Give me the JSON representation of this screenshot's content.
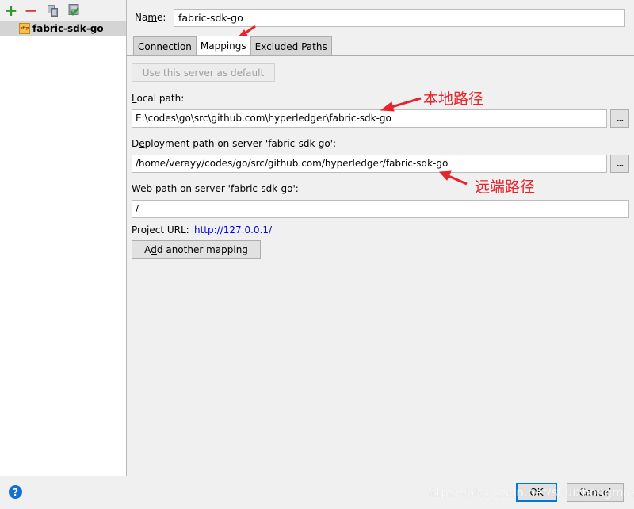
{
  "left_panel": {
    "toolbar": [
      {
        "name": "add-icon",
        "glyph": "+",
        "color": "#2e9a2e"
      },
      {
        "name": "remove-icon",
        "glyph": "−",
        "color": "#d93c3c"
      },
      {
        "name": "copy-icon",
        "glyph": "❐",
        "color": "#7d8a96"
      },
      {
        "name": "set-default-icon",
        "glyph": "✔",
        "color": "#2e9a2e"
      }
    ],
    "servers": [
      {
        "label": "fabric-sdk-go",
        "icon": "sftp",
        "selected": true
      }
    ]
  },
  "form": {
    "name_label_pre": "Na",
    "name_label_u": "m",
    "name_label_post": "e:",
    "name_value": "fabric-sdk-go",
    "tabs": [
      {
        "label": "Connection",
        "active": false
      },
      {
        "label": "Mappings",
        "active": true
      },
      {
        "label": "Excluded Paths",
        "active": false
      }
    ],
    "use_default_button": "Use this server as default",
    "local_path_label_u": "L",
    "local_path_label_rest": "ocal path:",
    "local_path_value": "E:\\codes\\go\\src\\github.com\\hyperledger\\fabric-sdk-go",
    "deploy_label_pre": "D",
    "deploy_label_u": "e",
    "deploy_label_rest": "ployment path on server 'fabric-sdk-go':",
    "deploy_value": "/home/verayy/codes/go/src/github.com/hyperledger/fabric-sdk-go",
    "web_label_u": "W",
    "web_label_rest": "eb path on server 'fabric-sdk-go':",
    "web_value": "/",
    "project_url_label": "Project URL:",
    "project_url_value": "http://127.0.0.1/",
    "add_mapping_pre": "A",
    "add_mapping_u": "d",
    "add_mapping_rest": "d another mapping",
    "browse_label": "..."
  },
  "annotations": {
    "local": "本地路径",
    "remote": "远端路径",
    "color": "#e8232a"
  },
  "footer": {
    "help": "?",
    "ok": "OK",
    "cancel": "Cancel",
    "watermark": "https://blog.csdn.net/shuizhongmose"
  }
}
